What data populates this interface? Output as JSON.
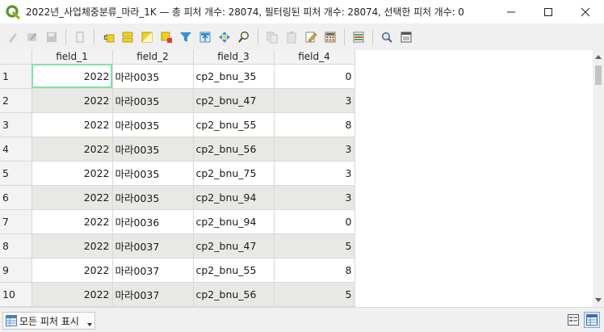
{
  "window": {
    "title": "2022년_사업체중분류_마라_1K — 총 피처 개수: 28074, 필터링된 피처 개수: 28074, 선택한 피처 개수: 0",
    "logo_icon": "qgis-logo-icon",
    "controls": [
      "minimize-icon",
      "maximize-icon",
      "close-icon"
    ]
  },
  "toolbar": {
    "buttons": [
      {
        "icon": "toggle-editing-icon"
      },
      {
        "icon": "multi-edit-icon"
      },
      {
        "icon": "save-edits-icon"
      },
      {
        "icon": "delete-features-icon"
      },
      {
        "icon": "select-by-expression-icon"
      },
      {
        "icon": "select-all-icon"
      },
      {
        "icon": "invert-selection-icon"
      },
      {
        "icon": "deselect-all-icon"
      },
      {
        "icon": "filter-select-icon"
      },
      {
        "icon": "move-selection-to-top-icon"
      },
      {
        "icon": "pan-to-selected-icon"
      },
      {
        "icon": "zoom-to-selected-icon"
      },
      {
        "icon": "copy-rows-icon"
      },
      {
        "icon": "paste-features-icon"
      },
      {
        "icon": "new-field-icon"
      },
      {
        "icon": "delete-field-icon"
      },
      {
        "icon": "field-calculator-icon"
      },
      {
        "icon": "conditional-formatting-icon"
      },
      {
        "icon": "actions-icon"
      },
      {
        "icon": "dock-table-icon"
      }
    ]
  },
  "table": {
    "columns": [
      "field_1",
      "field_2",
      "field_3",
      "field_4"
    ],
    "rows": [
      {
        "id": "1",
        "field_1": "2022",
        "field_2": "마라0035",
        "field_3": "cp2_bnu_35",
        "field_4": "0"
      },
      {
        "id": "2",
        "field_1": "2022",
        "field_2": "마라0035",
        "field_3": "cp2_bnu_47",
        "field_4": "3"
      },
      {
        "id": "3",
        "field_1": "2022",
        "field_2": "마라0035",
        "field_3": "cp2_bnu_55",
        "field_4": "8"
      },
      {
        "id": "4",
        "field_1": "2022",
        "field_2": "마라0035",
        "field_3": "cp2_bnu_56",
        "field_4": "3"
      },
      {
        "id": "5",
        "field_1": "2022",
        "field_2": "마라0035",
        "field_3": "cp2_bnu_75",
        "field_4": "3"
      },
      {
        "id": "6",
        "field_1": "2022",
        "field_2": "마라0035",
        "field_3": "cp2_bnu_94",
        "field_4": "3"
      },
      {
        "id": "7",
        "field_1": "2022",
        "field_2": "마라0036",
        "field_3": "cp2_bnu_94",
        "field_4": "0"
      },
      {
        "id": "8",
        "field_1": "2022",
        "field_2": "마라0037",
        "field_3": "cp2_bnu_47",
        "field_4": "5"
      },
      {
        "id": "9",
        "field_1": "2022",
        "field_2": "마라0037",
        "field_3": "cp2_bnu_55",
        "field_4": "8"
      },
      {
        "id": "10",
        "field_1": "2022",
        "field_2": "마라0037",
        "field_3": "cp2_bnu_56",
        "field_4": "5"
      }
    ]
  },
  "bottombar": {
    "filter_label": "모든 피처 표시",
    "view_buttons": [
      "form-view-icon",
      "table-view-icon"
    ]
  }
}
